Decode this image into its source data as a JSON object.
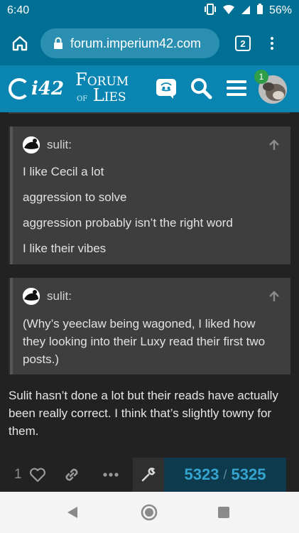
{
  "status_bar": {
    "time": "6:40",
    "battery": "56%"
  },
  "browser": {
    "url": "forum.imperium42.com",
    "tab_count": "2"
  },
  "site": {
    "logo_left": "i42",
    "logo_line1": "Forum",
    "logo_of": "of",
    "logo_line2": "Lies",
    "notification_count": "1"
  },
  "quotes": [
    {
      "author": "sulit:",
      "lines": [
        "I like Cecil a lot",
        "aggression to solve",
        "aggression probably isn’t the right word",
        "I like their vibes"
      ]
    },
    {
      "author": "sulit:",
      "lines": [
        "(Why’s yeeclaw being wagoned, I liked how",
        "they looking into their Luxy read their first two",
        "posts.)"
      ]
    }
  ],
  "post_body": "Sulit hasn’t done a lot but their reads have actually been really correct. I think that’s slightly towny for them.",
  "post_actions": {
    "like_count": "1"
  },
  "timeline": {
    "current": "5323",
    "separator": "/",
    "total": "5325"
  },
  "colors": {
    "brand": "#0a85b2",
    "browser_bar": "#006f94",
    "background": "#222222",
    "progress_text": "#34a4cf"
  }
}
